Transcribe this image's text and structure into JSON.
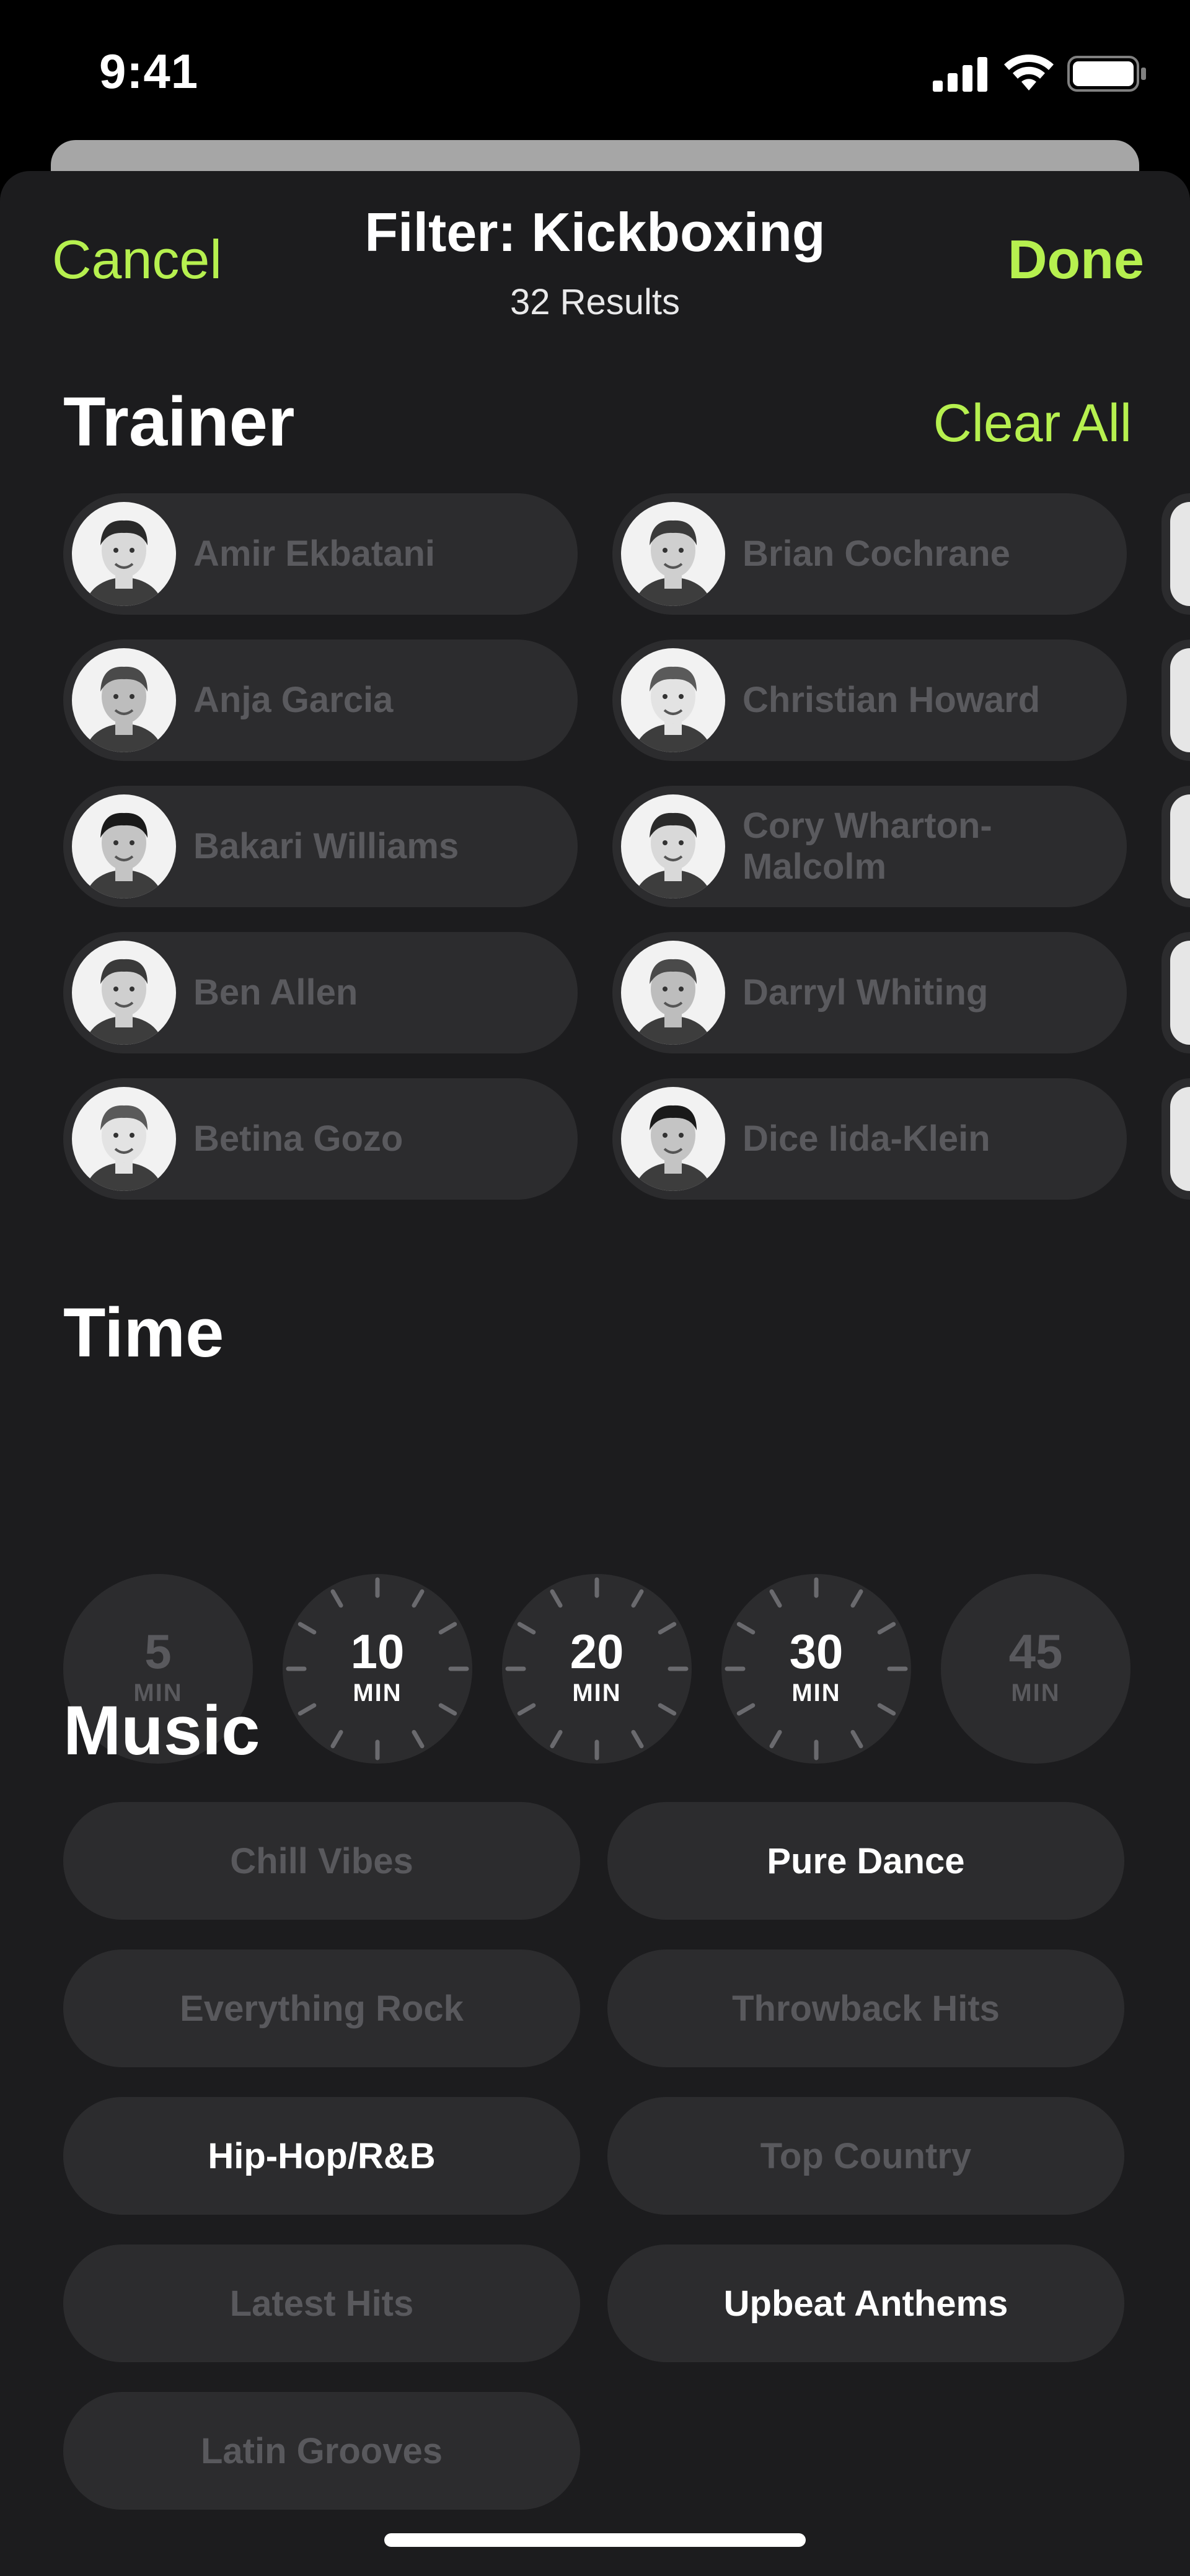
{
  "status_bar": {
    "time": "9:41"
  },
  "nav": {
    "cancel": "Cancel",
    "title": "Filter: Kickboxing",
    "subtitle": "32 Results",
    "done": "Done"
  },
  "trainer": {
    "title": "Trainer",
    "clear_all": "Clear All",
    "items": [
      {
        "name": "Amir Ekbatani"
      },
      {
        "name": "Brian Cochrane"
      },
      {
        "name": "Anja Garcia"
      },
      {
        "name": "Christian Howard"
      },
      {
        "name": "Bakari Williams"
      },
      {
        "name": "Cory Wharton-Malcolm"
      },
      {
        "name": "Ben Allen"
      },
      {
        "name": "Darryl Whiting"
      },
      {
        "name": "Betina Gozo"
      },
      {
        "name": "Dice Iida-Klein"
      }
    ]
  },
  "time": {
    "title": "Time",
    "options": [
      {
        "value": "5",
        "unit": "MIN",
        "selected": false
      },
      {
        "value": "10",
        "unit": "MIN",
        "selected": true
      },
      {
        "value": "20",
        "unit": "MIN",
        "selected": true
      },
      {
        "value": "30",
        "unit": "MIN",
        "selected": true
      },
      {
        "value": "45",
        "unit": "MIN",
        "selected": false
      }
    ]
  },
  "music": {
    "title": "Music",
    "items": [
      {
        "label": "Chill Vibes",
        "selected": false
      },
      {
        "label": "Pure Dance",
        "selected": true
      },
      {
        "label": "Everything Rock",
        "selected": false
      },
      {
        "label": "Throwback Hits",
        "selected": false
      },
      {
        "label": "Hip-Hop/R&B",
        "selected": true
      },
      {
        "label": "Top Country",
        "selected": false
      },
      {
        "label": "Latest Hits",
        "selected": false
      },
      {
        "label": "Upbeat Anthems",
        "selected": true
      },
      {
        "label": "Latin Grooves",
        "selected": false
      }
    ]
  },
  "colors": {
    "accent": "#b6f04f",
    "sheet_bg": "#1c1c1e",
    "pill_bg": "#2c2c2e",
    "unselected_text": "#59595d",
    "selected_text": "#ffffff"
  }
}
